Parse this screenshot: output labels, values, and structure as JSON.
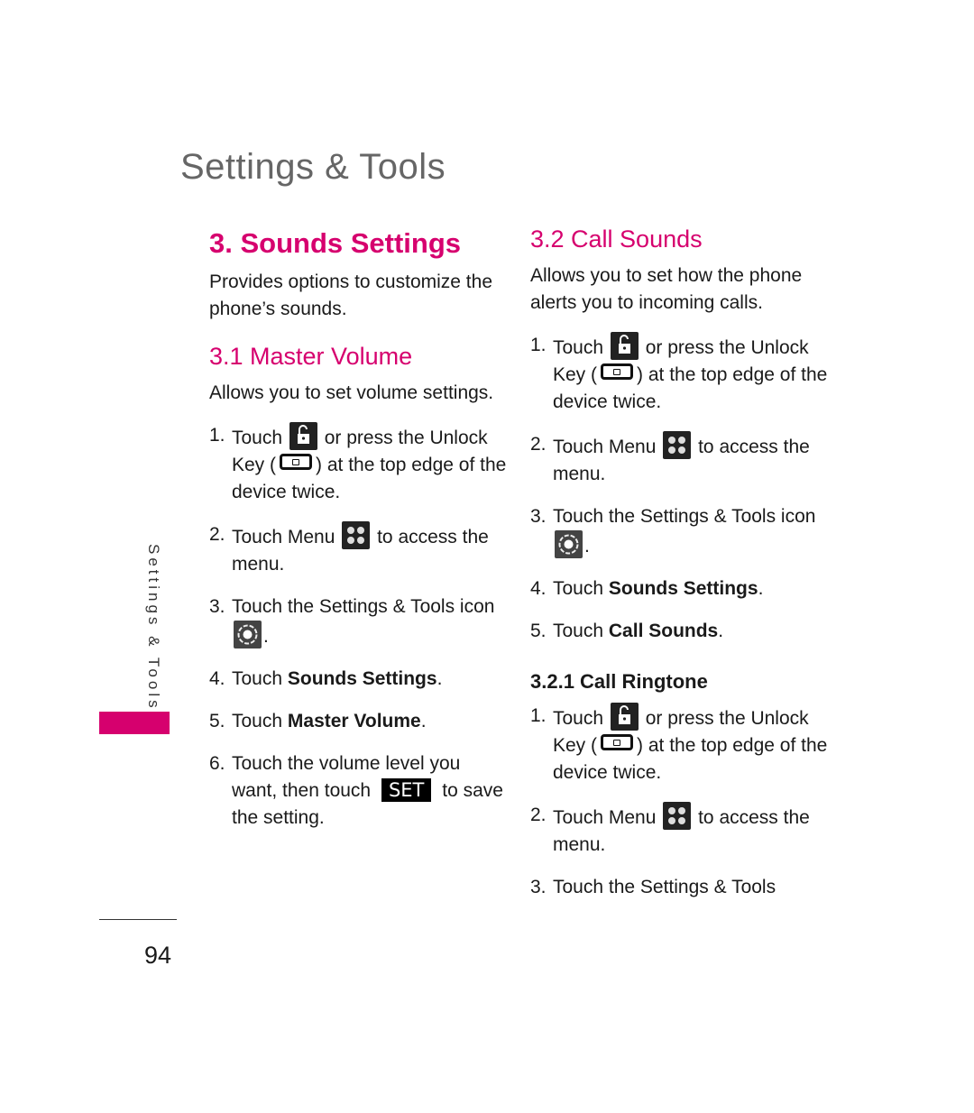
{
  "header": {
    "title": "Settings & Tools"
  },
  "side_tab": {
    "label": "Settings & Tools",
    "accent": "#d6006e"
  },
  "page_number": "94",
  "left": {
    "title": "3. Sounds Settings",
    "intro": "Provides options to customize the phone’s sounds.",
    "subsection": {
      "title": "3.1 Master Volume",
      "intro": "Allows you to set volume settings.",
      "steps": [
        {
          "num": "1.",
          "a": "Touch",
          "b": "or press the Unlock Key (",
          "c": ") at the top edge of the device twice."
        },
        {
          "num": "2.",
          "a": "Touch Menu",
          "b": "to access the menu."
        },
        {
          "num": "3.",
          "a": "Touch the Settings & Tools icon",
          "b": "."
        },
        {
          "num": "4.",
          "a": "Touch",
          "bold": "Sounds Settings",
          "b": "."
        },
        {
          "num": "5.",
          "a": "Touch",
          "bold": "Master Volume",
          "b": "."
        },
        {
          "num": "6.",
          "a": "Touch the volume level you want, then touch",
          "btn": "SET",
          "b": "to save the setting."
        }
      ]
    }
  },
  "right": {
    "title": "3.2 Call Sounds",
    "intro": "Allows you to set how the phone alerts you to incoming calls.",
    "steps": [
      {
        "num": "1.",
        "a": "Touch",
        "b": "or press the Unlock Key (",
        "c": ") at the top edge of the device twice."
      },
      {
        "num": "2.",
        "a": "Touch Menu",
        "b": "to access the menu."
      },
      {
        "num": "3.",
        "a": "Touch the Settings & Tools icon",
        "b": "."
      },
      {
        "num": "4.",
        "a": "Touch",
        "bold": "Sounds Settings",
        "b": "."
      },
      {
        "num": "5.",
        "a": "Touch",
        "bold": "Call Sounds",
        "b": "."
      }
    ],
    "subsection": {
      "title": "3.2.1 Call Ringtone",
      "steps": [
        {
          "num": "1.",
          "a": "Touch",
          "b": "or press the Unlock Key (",
          "c": ") at the top edge of the device twice."
        },
        {
          "num": "2.",
          "a": "Touch Menu",
          "b": "to access the menu."
        },
        {
          "num": "3.",
          "a": "Touch the Settings & Tools"
        }
      ]
    }
  },
  "icons": {
    "unlock": "unlock-icon",
    "menu": "menu-icon",
    "settings": "settings-gear-icon",
    "unlock_key": "unlock-key-icon"
  }
}
